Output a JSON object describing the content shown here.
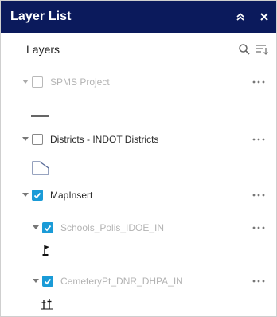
{
  "header": {
    "title": "Layer List",
    "collapse_icon": "double-chevron-up-icon",
    "close_icon": "close-icon"
  },
  "toolbar": {
    "label": "Layers",
    "search_icon": "search-icon",
    "filter_icon": "filter-list-icon"
  },
  "layers": [
    {
      "label": "SPMS Project",
      "checked": false,
      "dimmed": true,
      "legend": "line-symbol-icon"
    },
    {
      "label": "Districts - INDOT Districts",
      "checked": false,
      "dimmed": false,
      "legend": "polygon-symbol-icon"
    },
    {
      "label": "MapInsert",
      "checked": true,
      "dimmed": false
    },
    {
      "label": "Schools_Polis_IDOE_IN",
      "checked": true,
      "dimmed": true,
      "legend": "school-flag-icon"
    },
    {
      "label": "CemeteryPt_DNR_DHPA_IN",
      "checked": true,
      "dimmed": true,
      "legend": "cemetery-cross-icon"
    }
  ],
  "colors": {
    "titlebar": "#0b1a5c",
    "checkbox_checked": "#1a9bd7"
  }
}
